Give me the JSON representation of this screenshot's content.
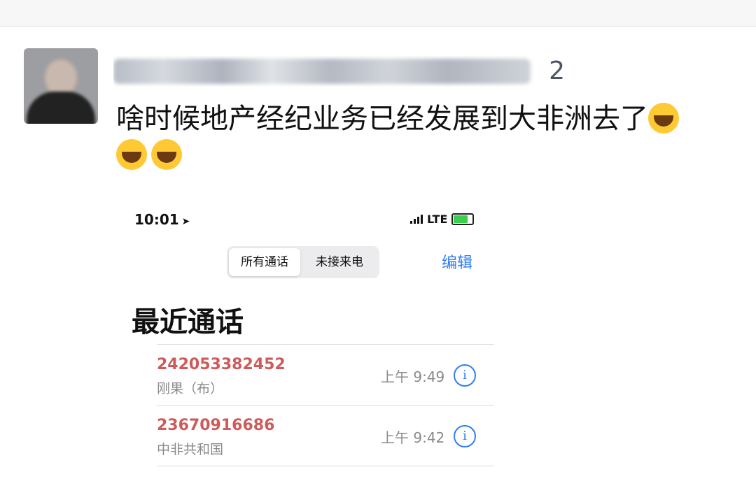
{
  "post": {
    "name_visible": "2",
    "text": "啥时候地产经纪业务已经发展到大非洲去了",
    "emoji_count": 3
  },
  "phone": {
    "status": {
      "time": "10:01",
      "network": "LTE"
    },
    "segment": {
      "all_calls": "所有通话",
      "missed_calls": "未接来电"
    },
    "edit_label": "编辑",
    "title": "最近通话",
    "calls": [
      {
        "number": "242053382452",
        "location": "刚果（布）",
        "time": "上午 9:49"
      },
      {
        "number": "23670916686",
        "location": "中非共和国",
        "time": "上午 9:42"
      }
    ],
    "info_glyph": "i"
  },
  "colors": {
    "missed_call": "#cf5a5a",
    "ios_blue": "#2f7ef6",
    "battery_green": "#3ccf4e"
  }
}
